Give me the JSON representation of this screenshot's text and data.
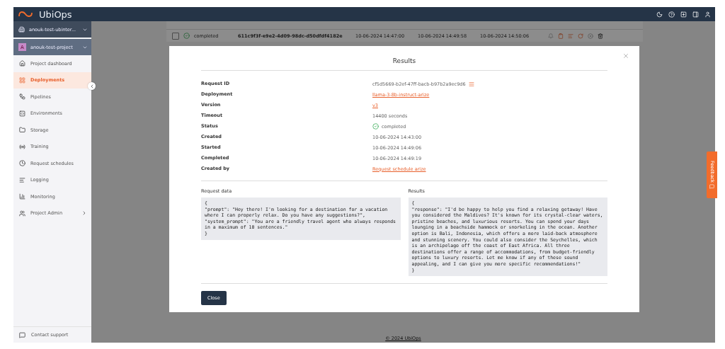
{
  "topbar": {
    "logo": "UbiOps"
  },
  "sidebar": {
    "organization": "anouk-test-ubinter...",
    "project": {
      "avatar": "A",
      "name": "anouk-test-project"
    },
    "items": [
      {
        "label": "Project dashboard",
        "selected": false,
        "expandable": false
      },
      {
        "label": "Deployments",
        "selected": true,
        "expandable": false
      },
      {
        "label": "Pipelines",
        "selected": false,
        "expandable": false
      },
      {
        "label": "Environments",
        "selected": false,
        "expandable": false
      },
      {
        "label": "Storage",
        "selected": false,
        "expandable": false
      },
      {
        "label": "Training",
        "selected": false,
        "expandable": false
      },
      {
        "label": "Request schedules",
        "selected": false,
        "expandable": false
      },
      {
        "label": "Logging",
        "selected": false,
        "expandable": false
      },
      {
        "label": "Monitoring",
        "selected": false,
        "expandable": false
      },
      {
        "label": "Project Admin",
        "selected": false,
        "expandable": true
      }
    ],
    "contact": "Contact support"
  },
  "table": {
    "rows": [
      {
        "checked": false,
        "status": "completed",
        "id": "611c9f3f-e9e2-4d09-98dc-d50dfdf4182e",
        "created": "10-06-2024 14:47:00",
        "started": "10-06-2024 14:49:58",
        "completed": "10-06-2024 14:50:06"
      }
    ]
  },
  "footer": "© 2024 UbiOps",
  "feedback": "Feedback",
  "modal": {
    "title": "Results",
    "fields": [
      {
        "label": "Request ID",
        "value": "cf5d5669-b2ef-47ff-bacb-b97b2a9ec9d6",
        "kind": "copy"
      },
      {
        "label": "Deployment",
        "value": "llama-3-8b-instruct-arize",
        "kind": "link"
      },
      {
        "label": "Version",
        "value": "v3",
        "kind": "link"
      },
      {
        "label": "Timeout",
        "value": "14400 seconds",
        "kind": "text"
      },
      {
        "label": "Status",
        "value": "completed",
        "kind": "status"
      },
      {
        "label": "Created",
        "value": "10-06-2024 14:43:00",
        "kind": "text"
      },
      {
        "label": "Started",
        "value": "10-06-2024 14:49:06",
        "kind": "text"
      },
      {
        "label": "Completed",
        "value": "10-06-2024 14:49:19",
        "kind": "text"
      },
      {
        "label": "Created by",
        "value": "Request schedule arize",
        "kind": "link"
      }
    ],
    "request_data": {
      "title": "Request data",
      "lines": [
        "{",
        "\"prompt\": \"Hey there! I'm looking for a destination for a vacation where I can properly relax. Do you have any suggestions?\",",
        "\"system_prompt\": \"You are a friendly travel agent who always responds in a maximum of 10 sentences.\"",
        "}"
      ]
    },
    "results": {
      "title": "Results",
      "lines": [
        "{",
        "\"response\": \"I'd be happy to help you find a relaxing getaway! Have you considered the Maldives? It's known for its crystal-clear waters, pristine beaches, and luxurious resorts. You can spend your days lounging in a beachside hammock or snorkeling in the ocean. Another option is Bali, Indonesia, which offers a more laid-back atmosphere and stunning scenery. You could also consider the Seychelles, which is an archipelago off the coast of East Africa. All three destinations offer a range of accommodations, from budget-friendly options to luxury resorts. Let me know if any of these sound appealing, and I can give you more specific recommendations!\"",
        "}"
      ]
    },
    "close_button": "Close"
  }
}
